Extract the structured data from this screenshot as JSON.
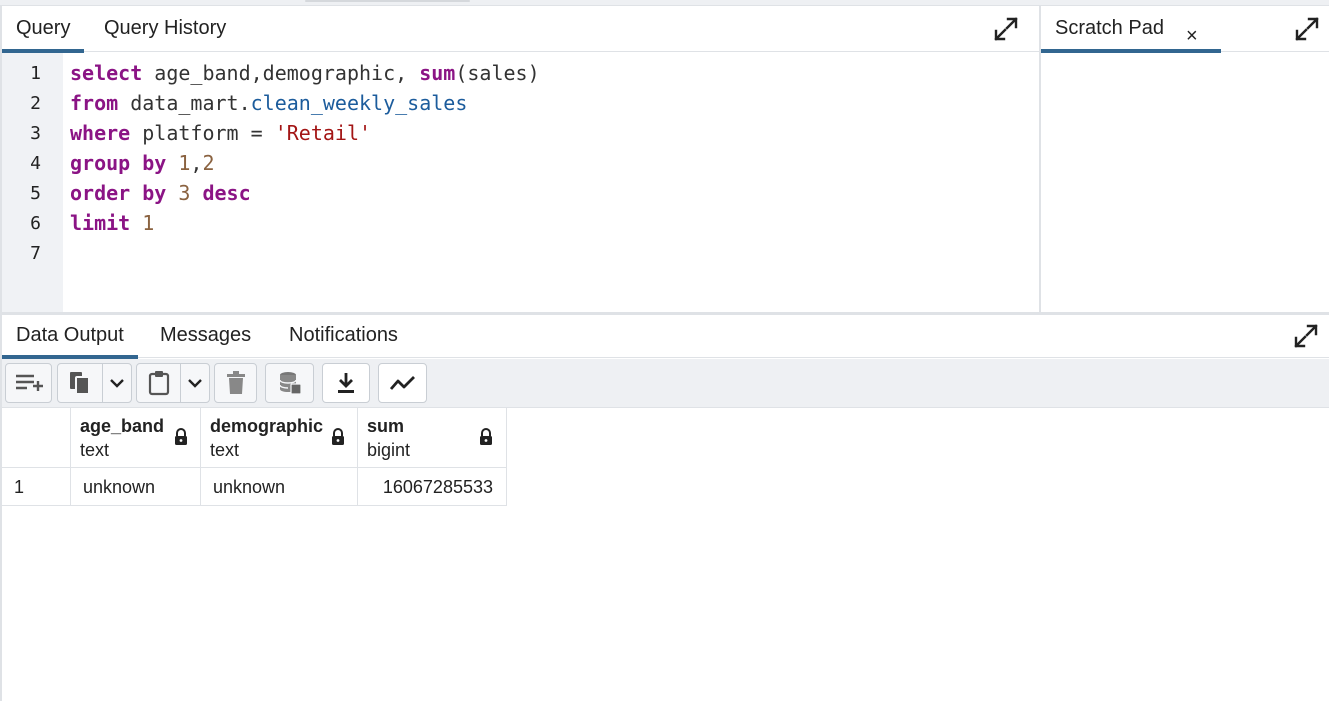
{
  "query_pane": {
    "tabs": [
      {
        "label": "Query",
        "active": true
      },
      {
        "label": "Query History",
        "active": false
      }
    ],
    "line_numbers": [
      "1",
      "2",
      "3",
      "4",
      "5",
      "6",
      "7"
    ],
    "code": {
      "line1": {
        "kw": "select",
        "col1": " age_band,demographic, ",
        "fn": "sum",
        "arg": "(sales)"
      },
      "line2": {
        "kw": "from",
        "schema": " data_mart.",
        "table": "clean_weekly_sales"
      },
      "line3": {
        "kw": "where",
        "lhs": " platform = ",
        "str": "'Retail'"
      },
      "line4": {
        "kw": "group by",
        "n1": " 1",
        "comma": ",",
        "n2": "2"
      },
      "line5": {
        "kw": "order by",
        "n": " 3",
        "kw2": " desc"
      },
      "line6": {
        "kw": "limit",
        "n": " 1"
      },
      "line7": ""
    }
  },
  "scratch_pad": {
    "tab_label": "Scratch Pad",
    "close_glyph": "×"
  },
  "output_pane": {
    "tabs": [
      {
        "label": "Data Output",
        "active": true
      },
      {
        "label": "Messages",
        "active": false
      },
      {
        "label": "Notifications",
        "active": false
      }
    ],
    "toolbar_icons": [
      "add-row-icon",
      "copy-icon",
      "chevron-down-icon",
      "paste-icon",
      "chevron-down-icon",
      "delete-icon",
      "save-data-icon",
      "download-icon",
      "graph-icon"
    ],
    "columns": [
      {
        "name": "age_band",
        "type": "text"
      },
      {
        "name": "demographic",
        "type": "text"
      },
      {
        "name": "sum",
        "type": "bigint"
      }
    ],
    "rows": [
      {
        "num": "1",
        "age_band": "unknown",
        "demographic": "unknown",
        "sum": "16067285533"
      }
    ]
  },
  "colors": {
    "active_tab_underline": "#326690",
    "keyword": "#8b1485",
    "number": "#8a6240",
    "string": "#a31515",
    "identifier": "#1c5c9c",
    "gutter_bg": "#f0f2f5",
    "toolbar_bg": "#eef0f3"
  }
}
